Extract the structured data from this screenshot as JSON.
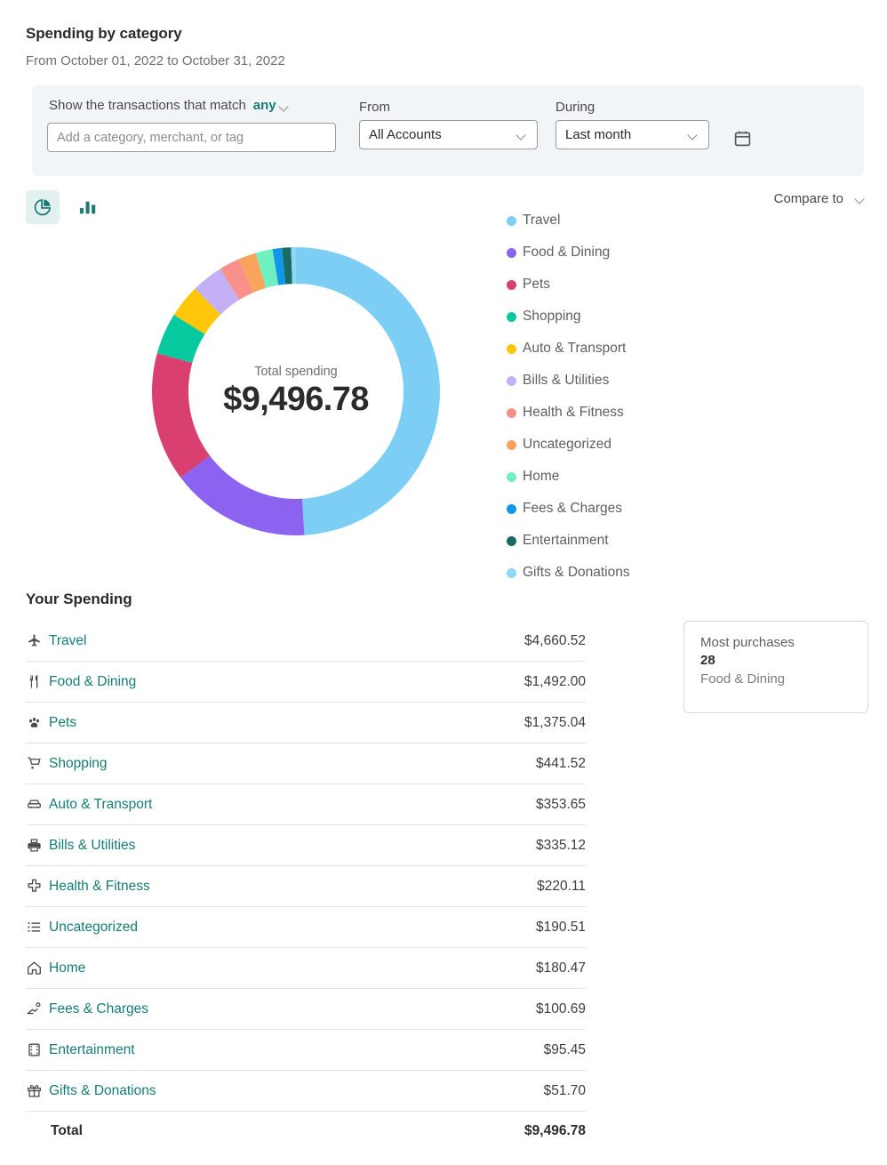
{
  "header": {
    "title": "Spending by category",
    "subtitle": "From October 01, 2022 to October 31, 2022"
  },
  "filter": {
    "match_label": "Show the transactions that match",
    "match_value": "any",
    "search_placeholder": "Add a category, merchant, or tag",
    "search_value": "",
    "from_label": "From",
    "from_value": "All Accounts",
    "during_label": "During",
    "during_value": "Last month",
    "calendar_icon": "calendar-icon",
    "chevron_icon": "chevron-down-icon"
  },
  "chart_toggle": {
    "pie_icon": "pie-chart-icon",
    "bar_icon": "bar-chart-icon",
    "active": "pie"
  },
  "compare": {
    "label": "Compare to",
    "chevron_icon": "chevron-down-icon"
  },
  "donut": {
    "center_label": "Total spending",
    "center_total": "$9,496.78"
  },
  "spending": {
    "section_title": "Your Spending",
    "total_label": "Total",
    "total_value": "$9,496.78",
    "rows": [
      {
        "name": "Travel",
        "amount": "$4,660.52",
        "icon": "airplane-icon"
      },
      {
        "name": "Food & Dining",
        "amount": "$1,492.00",
        "icon": "fork-knife-icon"
      },
      {
        "name": "Pets",
        "amount": "$1,375.04",
        "icon": "paw-icon"
      },
      {
        "name": "Shopping",
        "amount": "$441.52",
        "icon": "shopping-cart-icon"
      },
      {
        "name": "Auto & Transport",
        "amount": "$353.65",
        "icon": "car-icon"
      },
      {
        "name": "Bills & Utilities",
        "amount": "$335.12",
        "icon": "printer-icon"
      },
      {
        "name": "Health & Fitness",
        "amount": "$220.11",
        "icon": "medical-cross-icon"
      },
      {
        "name": "Uncategorized",
        "amount": "$190.51",
        "icon": "list-icon"
      },
      {
        "name": "Home",
        "amount": "$180.47",
        "icon": "house-icon"
      },
      {
        "name": "Fees & Charges",
        "amount": "$100.69",
        "icon": "hand-coin-icon"
      },
      {
        "name": "Entertainment",
        "amount": "$95.45",
        "icon": "film-icon"
      },
      {
        "name": "Gifts & Donations",
        "amount": "$51.70",
        "icon": "gift-icon"
      }
    ]
  },
  "most_purchases": {
    "title": "Most purchases",
    "count": "28",
    "category": "Food & Dining"
  },
  "chart_data": {
    "type": "pie",
    "title": "Spending by category",
    "subtitle": "From October 01, 2022 to October 31, 2022",
    "center_label": "Total spending",
    "total": 9496.78,
    "total_formatted": "$9,496.78",
    "currency": "USD",
    "legend_position": "right",
    "donut": true,
    "categories": [
      "Travel",
      "Food & Dining",
      "Pets",
      "Shopping",
      "Auto & Transport",
      "Bills & Utilities",
      "Health & Fitness",
      "Uncategorized",
      "Home",
      "Fees & Charges",
      "Entertainment",
      "Gifts & Donations"
    ],
    "values": [
      4660.52,
      1492.0,
      1375.04,
      441.52,
      353.65,
      335.12,
      220.11,
      190.51,
      180.47,
      100.69,
      95.45,
      51.7
    ],
    "value_labels": [
      "$4,660.52",
      "$1,492.00",
      "$1,375.04",
      "$441.52",
      "$353.65",
      "$335.12",
      "$220.11",
      "$190.51",
      "$180.47",
      "$100.69",
      "$95.45",
      "$51.70"
    ],
    "colors": [
      "#7ccef4",
      "#8c62f0",
      "#d94070",
      "#07c9a0",
      "#ffc60a",
      "#c3b0f5",
      "#f79189",
      "#f9a košice",
      "#6ff0c0",
      "#1296e8",
      "#1a6b64",
      "#8ed8f8"
    ],
    "slice_colors": {
      "Travel": "#7ccef4",
      "Food & Dining": "#8c62f0",
      "Pets": "#d94070",
      "Shopping": "#07c9a0",
      "Auto & Transport": "#ffc60a",
      "Bills & Utilities": "#c3b0f5",
      "Health & Fitness": "#f79189",
      "Uncategorized": "#f9a45c",
      "Home": "#6ff0c0",
      "Fees & Charges": "#1296e8",
      "Entertainment": "#1a6b64",
      "Gifts & Donations": "#8ed8f8"
    },
    "percentages": [
      49.07,
      15.71,
      14.48,
      4.65,
      3.72,
      3.53,
      2.32,
      2.01,
      1.9,
      1.06,
      1.0,
      0.54
    ]
  }
}
